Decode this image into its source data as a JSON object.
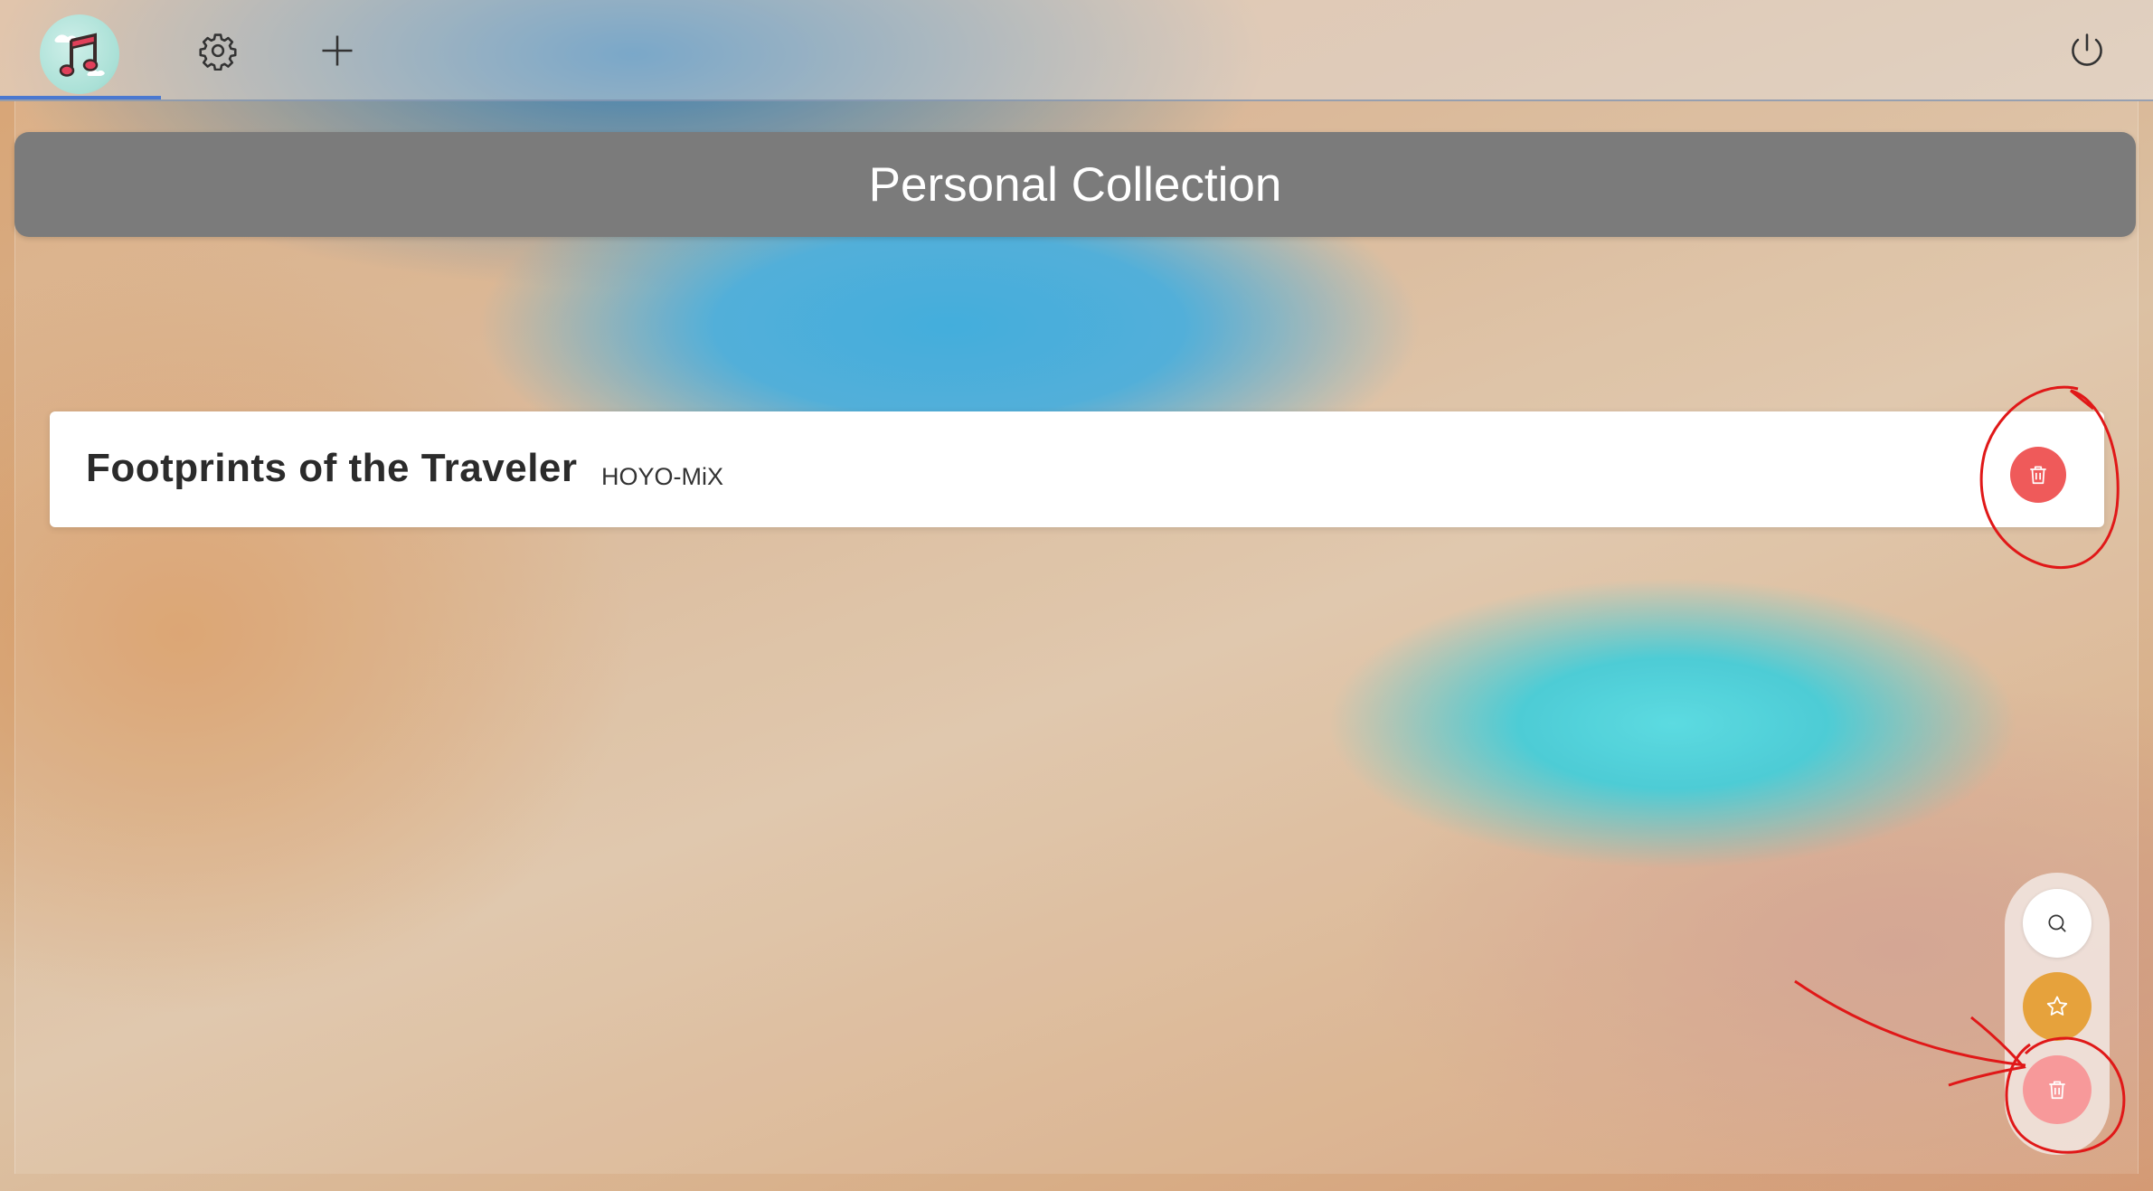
{
  "app": {
    "logo_icon": "music-note-icon",
    "nav": {
      "settings_icon": "gear-icon",
      "add_icon": "plus-icon",
      "power_icon": "power-icon"
    }
  },
  "collection": {
    "title": "Personal Collection"
  },
  "songs": [
    {
      "title": "Footprints of the Traveler",
      "artist": "HOYO-MiX",
      "action_icon": "trash-icon"
    }
  ],
  "fab": {
    "search_icon": "search-icon",
    "star_icon": "star-icon",
    "delete_icon": "trash-icon"
  },
  "colors": {
    "header_bg": "#7b7b7b",
    "delete_red": "#ef5a5a",
    "star_orange": "#e6a23c",
    "fab_delete_pink": "#f7999a",
    "annotation_red": "#e01818",
    "tab_indicator": "#4a78d0"
  }
}
